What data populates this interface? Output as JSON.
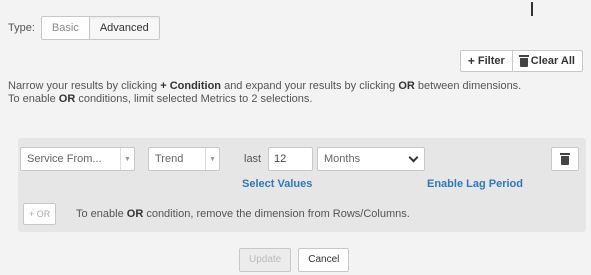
{
  "type_selector": {
    "label": "Type:",
    "options": [
      "Basic",
      "Advanced"
    ],
    "selected": "Advanced"
  },
  "toolbar": {
    "filter_label": "Filter",
    "clear_all_label": "Clear All"
  },
  "help": {
    "line1_a": "Narrow your results by clicking ",
    "line1_plus": "+ Condition",
    "line1_b": " and expand your results by clicking ",
    "line1_or": "OR",
    "line1_c": " between dimensions.",
    "line2_a": "To enable ",
    "line2_or": "OR",
    "line2_b": " conditions, limit selected Metrics to 2 selections."
  },
  "condition": {
    "dimension_value": "Service From...",
    "operator_value": "Trend",
    "last_label": "last",
    "period_number": "12",
    "period_unit": "Months",
    "select_values_link": "Select Values",
    "enable_lag_link": "Enable Lag Period",
    "or_button_label": "+ OR",
    "or_note_a": "To enable ",
    "or_note_or": "OR",
    "or_note_b": " condition, remove the dimension from Rows/Columns."
  },
  "footer": {
    "update_label": "Update",
    "cancel_label": "Cancel"
  },
  "colors": {
    "background": "#f3f3f3",
    "panel": "#e6e6e6",
    "link": "#2f79b8"
  },
  "icons": [
    "plus-icon",
    "trash-icon",
    "chevron-down-icon",
    "caret-down-icon"
  ]
}
